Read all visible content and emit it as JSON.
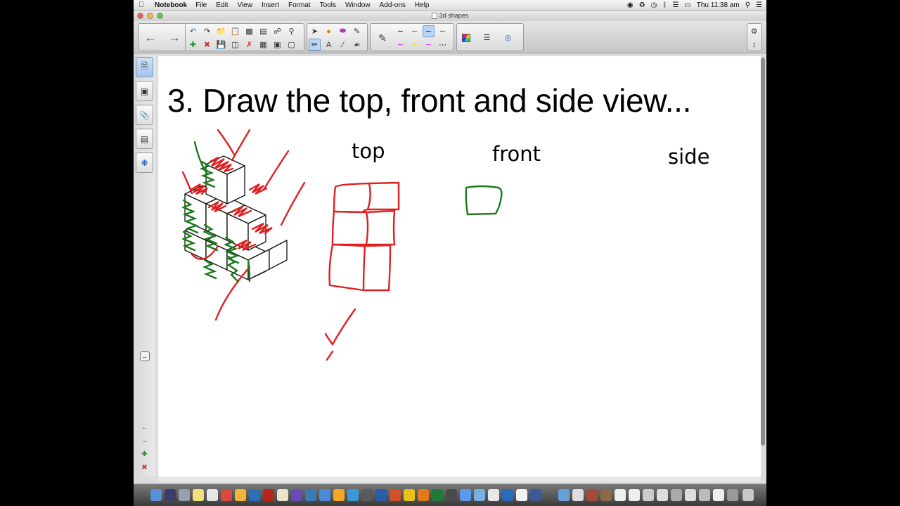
{
  "menubar": {
    "app_name": "Notebook",
    "menus": [
      "File",
      "Edit",
      "View",
      "Insert",
      "Format",
      "Tools",
      "Window",
      "Add-ons",
      "Help"
    ],
    "clock": "Thu 11:38 am"
  },
  "window": {
    "title": "3d shapes"
  },
  "page": {
    "title": "3. Draw the top, front and side view...",
    "labels": {
      "top": "top",
      "front": "front",
      "side": "side"
    }
  },
  "colors": {
    "ink_red": "#e02020",
    "ink_green": "#1a7a1a",
    "page_bg": "#ffffff",
    "toolbar_bg": "#d4d4d4"
  },
  "icons": {
    "toolbar": [
      "back-icon",
      "forward-icon",
      "undo-icon",
      "redo-icon",
      "open-icon",
      "paste-icon",
      "screen-shade-icon",
      "document-camera-icon",
      "select-icon",
      "fill-icon",
      "eraser-icon",
      "pen-icon",
      "color-palette-icon",
      "line-style-icon",
      "transparency-icon",
      "settings-icon"
    ],
    "sidebar": [
      "page-sorter-icon",
      "gallery-icon",
      "attachments-icon",
      "properties-icon",
      "addons-icon"
    ]
  }
}
